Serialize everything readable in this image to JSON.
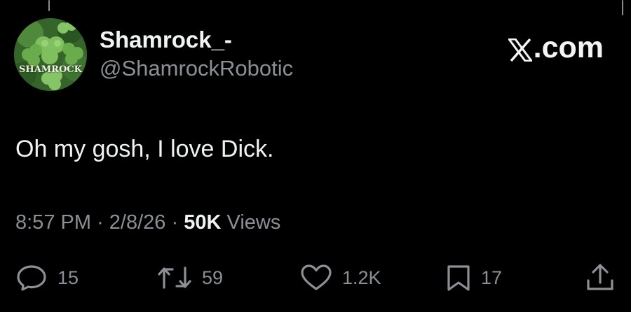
{
  "author": {
    "display_name": "Shamrock_-",
    "handle": "@ShamrockRobotic",
    "avatar_text": "SHAMROCK"
  },
  "brand": {
    "label": ".com",
    "icon": "x-logo-icon"
  },
  "tweet": {
    "text": "Oh my gosh, I love Dick."
  },
  "meta": {
    "time": "8:57 PM",
    "separator": "·",
    "date": "2/8/26",
    "views_count": "50K",
    "views_label": "Views"
  },
  "actions": {
    "reply": {
      "icon": "reply-bubble-icon",
      "count": "15"
    },
    "retweet": {
      "icon": "retweet-icon",
      "count": "59"
    },
    "like": {
      "icon": "heart-icon",
      "count": "1.2K"
    },
    "bookmark": {
      "icon": "bookmark-icon",
      "count": "17"
    },
    "share": {
      "icon": "share-icon"
    }
  },
  "colors": {
    "background": "#000000",
    "primary_text": "#e7e9ea",
    "secondary_text": "#8b9095",
    "avatar_green": "#3f7a2c"
  }
}
